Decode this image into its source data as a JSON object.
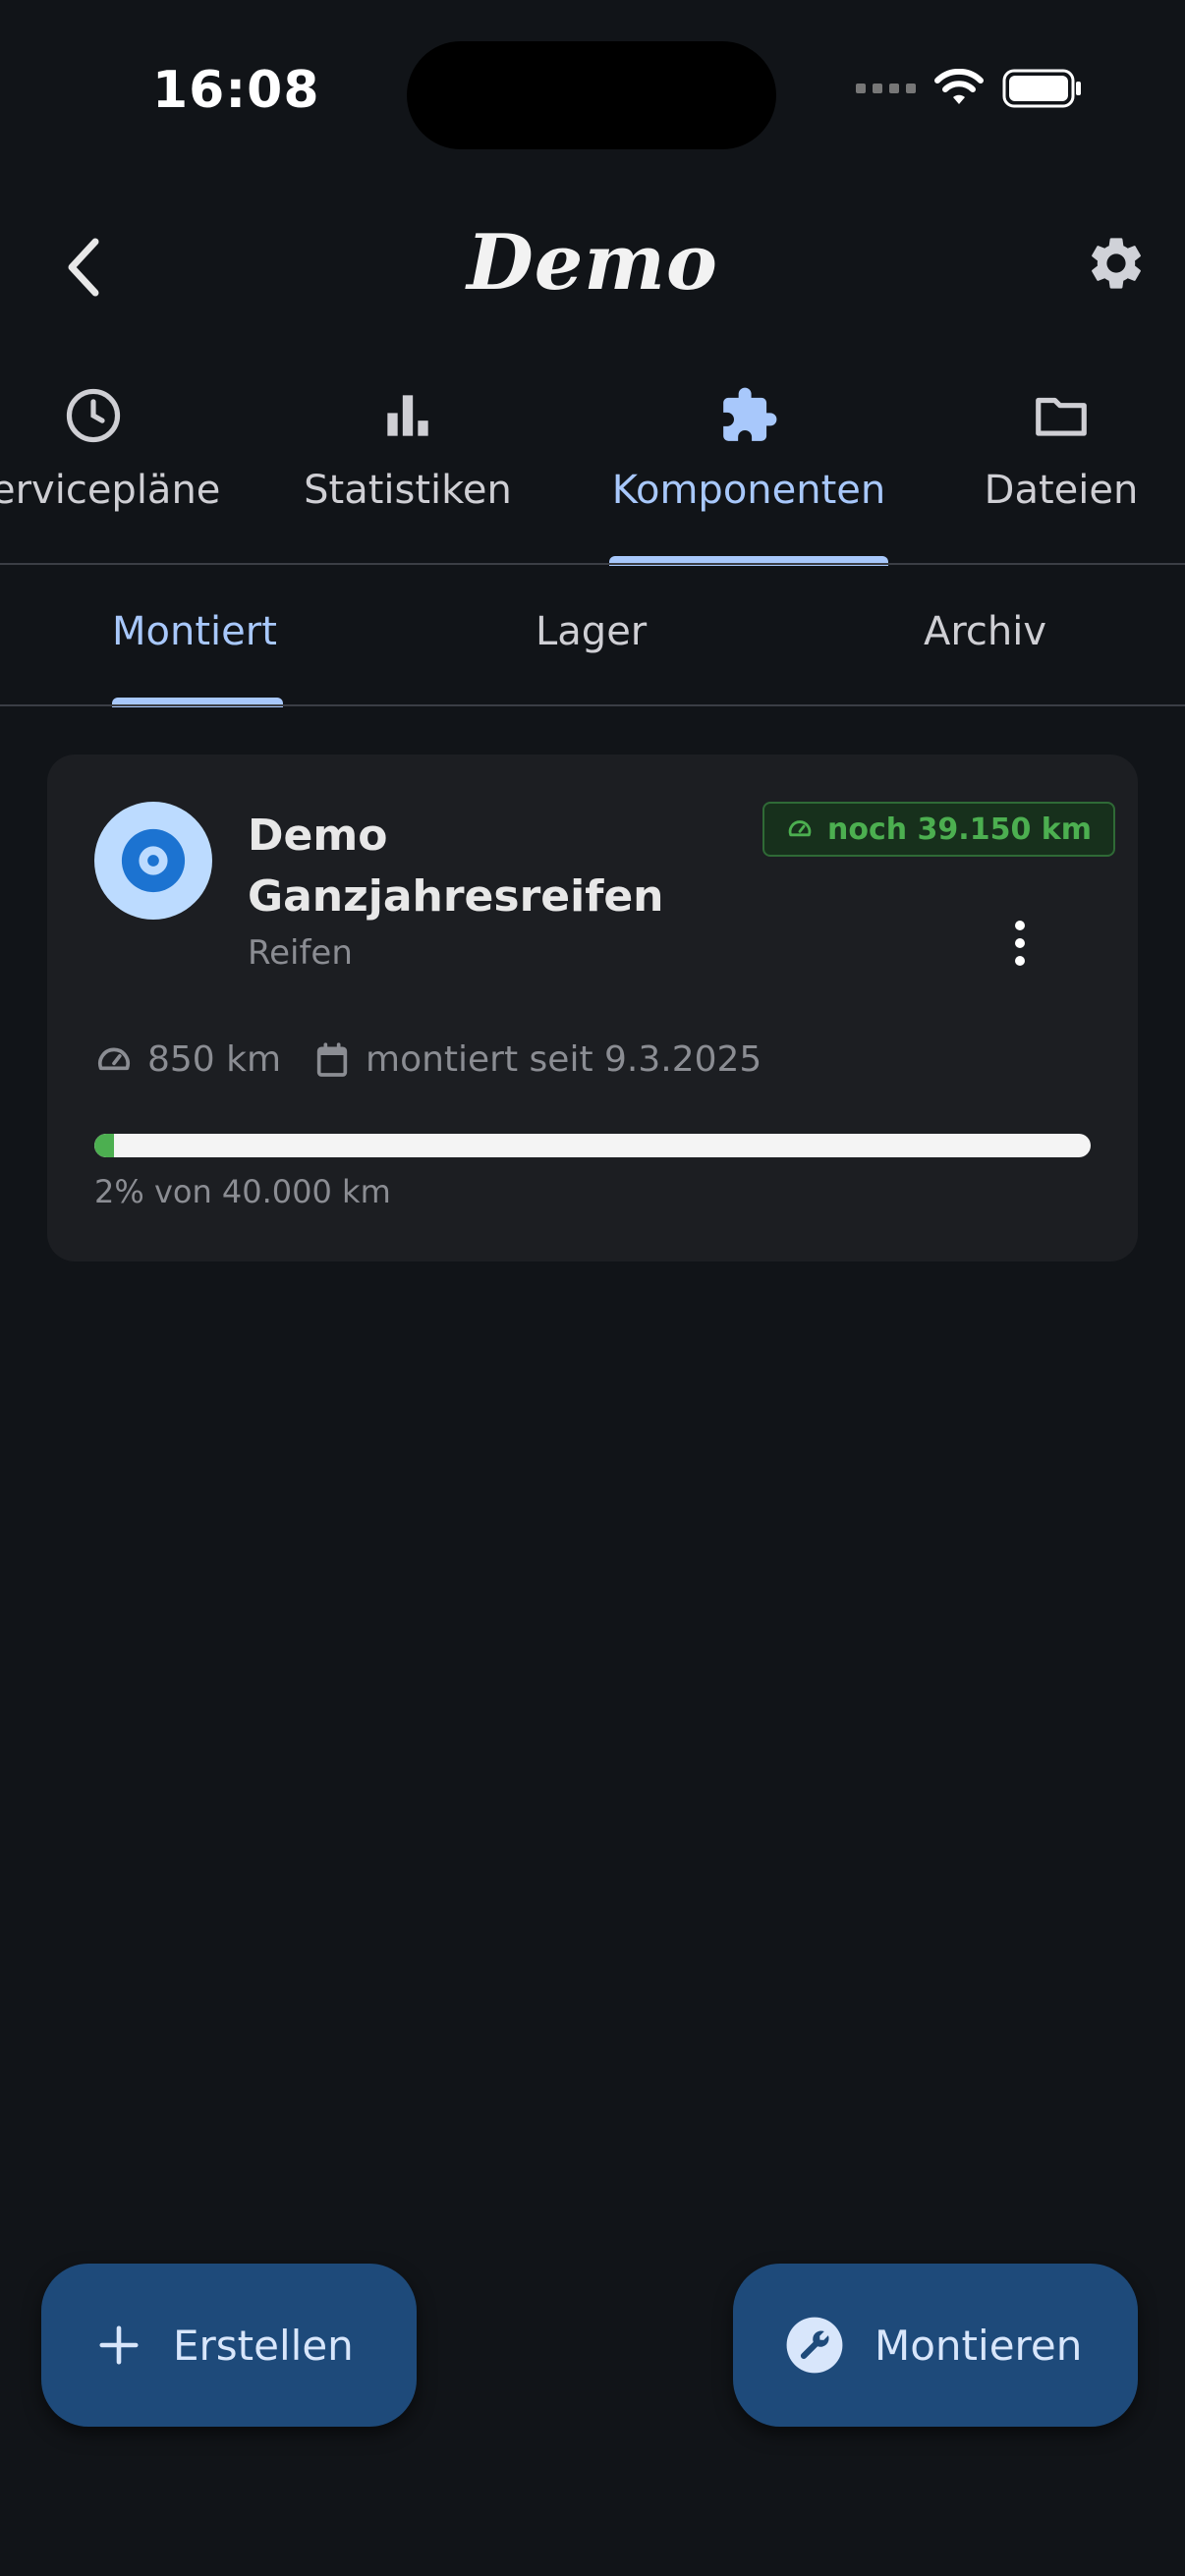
{
  "status_bar": {
    "time": "16:08"
  },
  "header": {
    "title": "Demo"
  },
  "main_tabs": [
    {
      "label": "Servicepläne",
      "icon": "clock-icon"
    },
    {
      "label": "Statistiken",
      "icon": "bar-chart-icon"
    },
    {
      "label": "Komponenten",
      "icon": "puzzle-icon",
      "active": true
    },
    {
      "label": "Dateien",
      "icon": "folder-icon"
    }
  ],
  "sub_tabs": [
    {
      "label": "Montiert",
      "active": true
    },
    {
      "label": "Lager"
    },
    {
      "label": "Archiv"
    }
  ],
  "component": {
    "name": "Demo Ganzjahresreifen",
    "type": "Reifen",
    "remaining": "noch 39.150 km",
    "mileage": "850 km",
    "mounted_since": "montiert seit 9.3.2025",
    "progress_fraction": 0.02,
    "progress_text": "2% von 40.000 km"
  },
  "actions": {
    "create_label": "Erstellen",
    "mount_label": "Montieren"
  },
  "colors": {
    "accent": "#a8c8fb",
    "success": "#4caf50",
    "fab": "#1e4a7a",
    "background": "#111418"
  }
}
